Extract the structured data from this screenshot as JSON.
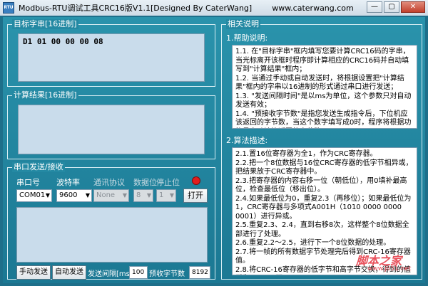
{
  "window": {
    "title": "Modbus-RTU调试工具CRC16版V1.1[Designed By CaterWang]",
    "url": "www.caterwang.com",
    "app_icon": "RTU",
    "controls": {
      "minimize": "—",
      "maximize": "▢",
      "close": "✕"
    }
  },
  "target": {
    "title": "目标字串[16进制]",
    "value": "D1 01 00 00 00 08"
  },
  "result": {
    "title": "计算结果[16进制]",
    "value": ""
  },
  "serial": {
    "title": "串口发送/接收",
    "port_label": "串口号",
    "baud_label": "波特率",
    "protocol_label": "通讯协议",
    "databits_label": "数据位",
    "stopbits_label": "停止位",
    "port_value": "COM01",
    "baud_value": "9600",
    "protocol_value": "None",
    "databits_value": "8",
    "stopbits_value": "1",
    "open_button": "打开",
    "led_color": "#e21d1d",
    "log_value": ""
  },
  "bottom": {
    "manual_send": "手动发送",
    "auto_send": "自动发送",
    "interval_label": "发送间隔[ms]",
    "interval_value": "100",
    "expected_label": "预收字节数",
    "expected_value": "8192"
  },
  "help": {
    "title": "相关说明",
    "section1": "1.帮助说明:",
    "lines1": [
      "1.1. 在\"目标字串\"框内填写您要计算CRC16码的字串，当光标离开该框时程序即计算相应的CRC16码并自动填写到\"计算结果\"框内；",
      "1.2. 当通过手动或自动发送时，将根据设置把\"计算结果\"框内的字串以16进制的形式通过串口进行发送；",
      "1.3. \"发送间隔时间\"是以ms为单位，这个参数只对自动发送有效；",
      "1.4. \"预接收字节数\"是指您发送生成指令后，下位机应该返回的字节数，当这个数字填写成0时，程序将根据功能号自动计算返回的字节数；"
    ],
    "section2": "2.算法描述:",
    "lines2": [
      "2.1.置16位寄存器为全1，作为CRC寄存器。",
      "2.2.把一个8位数据与16位CRC寄存器的低字节相异或，把结果放于CRC寄存器中。",
      "2.3.把寄存器的内容右移一位（朝低位），用0填补最高位，检查最低位（移出位）。",
      "2.4.如果最低位为0，重复2.3（再移位）；如果最低位为1，CRC寄存器与多项式A001H（1010 0000 0000 0001）进行异或。",
      "2.5.重复2.3、2.4，直到右移8次，这样整个8位数据全部进行了处理。",
      "2.6.重复2.2～2.5，进行下一个8位数据的处理。",
      "2.7.将一帧的所有数据字节处理完后得到CRC-16寄存器值。",
      "2.8.将CRC-16寄存器的低字节和高字节交换，得到的值即为CRC-16码。"
    ],
    "watermark": "脚本之家",
    "watermark_url": "www.jb51.net"
  }
}
